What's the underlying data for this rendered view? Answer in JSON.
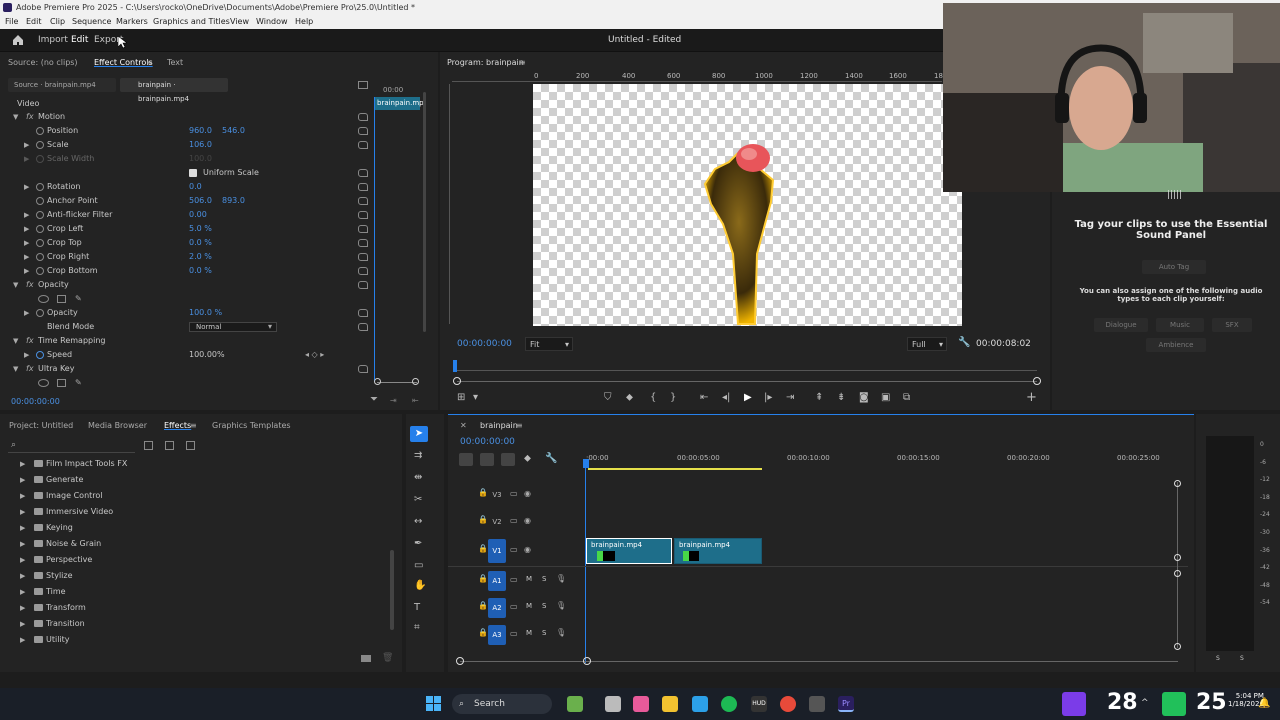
{
  "window": {
    "title": "Adobe Premiere Pro 2025 - C:\\Users\\rocko\\OneDrive\\Documents\\Adobe\\Premiere Pro\\25.0\\Untitled *"
  },
  "menu": [
    "File",
    "Edit",
    "Clip",
    "Sequence",
    "Markers",
    "Graphics and Titles",
    "View",
    "Window",
    "Help"
  ],
  "header": {
    "import": "Import",
    "edit": "Edit",
    "export": "Export",
    "project_title": "Untitled - Edited"
  },
  "source_panel": {
    "tabs": [
      "Source: (no clips)",
      "Effect Controls",
      "Text"
    ],
    "sub_tabs": [
      "Source · brainpain.mp4",
      "brainpain · brainpain.mp4"
    ],
    "mini_time": "00:00",
    "mini_clip": "brainpain.mp",
    "timecode": "00:00:00:00"
  },
  "effect_controls": {
    "video": "Video",
    "motion": "Motion",
    "position": "Position",
    "position_x": "960.0",
    "position_y": "546.0",
    "scale": "Scale",
    "scale_val": "106.0",
    "scale_width": "Scale Width",
    "scale_width_val": "100.0",
    "uniform": "Uniform Scale",
    "rotation": "Rotation",
    "rotation_val": "0.0",
    "anchor": "Anchor Point",
    "anchor_x": "506.0",
    "anchor_y": "893.0",
    "antiflicker": "Anti-flicker Filter",
    "antiflicker_val": "0.00",
    "crop_left": "Crop Left",
    "crop_left_val": "5.0 %",
    "crop_top": "Crop Top",
    "crop_top_val": "0.0 %",
    "crop_right": "Crop Right",
    "crop_right_val": "2.0 %",
    "crop_bottom": "Crop Bottom",
    "crop_bottom_val": "0.0 %",
    "opacity_group": "Opacity",
    "opacity": "Opacity",
    "opacity_val": "100.0 %",
    "blend": "Blend Mode",
    "blend_val": "Normal",
    "time_remap": "Time Remapping",
    "speed": "Speed",
    "speed_val": "100.00%",
    "ultra_key": "Ultra Key"
  },
  "program": {
    "title": "Program: brainpain",
    "ruler": [
      "0",
      "200",
      "400",
      "600",
      "800",
      "1000",
      "1200",
      "1400",
      "1600",
      "18"
    ],
    "timecode": "00:00:00:00",
    "fit": "Fit",
    "full": "Full",
    "duration": "00:00:08:02"
  },
  "sound_panel": {
    "heading": "Tag your clips to use the Essential Sound Panel",
    "auto_tag": "Auto Tag",
    "desc": "You can also assign one of the following audio types to each clip yourself:",
    "dialogue": "Dialogue",
    "music": "Music",
    "sfx": "SFX",
    "ambience": "Ambience"
  },
  "project_panel": {
    "tabs": [
      "Project: Untitled",
      "Media Browser",
      "Effects",
      "Graphics Templates"
    ],
    "search_placeholder": "",
    "effects": [
      "Film Impact Tools FX",
      "Generate",
      "Image Control",
      "Immersive Video",
      "Keying",
      "Noise & Grain",
      "Perspective",
      "Stylize",
      "Time",
      "Transform",
      "Transition",
      "Utility"
    ]
  },
  "timeline": {
    "title": "brainpain",
    "timecode": "00:00:00:00",
    "ruler": [
      ":00:00",
      "00:00:05:00",
      "00:00:10:00",
      "00:00:15:00",
      "00:00:20:00",
      "00:00:25:00"
    ],
    "video_tracks": [
      "V3",
      "V2",
      "V1"
    ],
    "audio_tracks": [
      "A1",
      "A2",
      "A3"
    ],
    "clips": [
      "brainpain.mp4",
      "brainpain.mp4"
    ],
    "mute": "M",
    "solo": "S"
  },
  "meter": {
    "scale": [
      "0",
      "-6",
      "-12",
      "-18",
      "-24",
      "-30",
      "-36",
      "-42",
      "-48",
      "-54"
    ],
    "s1": "S",
    "s2": "S"
  },
  "taskbar": {
    "search": "Search",
    "temp": "28",
    "time": "5:04 PM",
    "date": "1/18/2026",
    "big": "25"
  },
  "colors": {
    "accent": "#2680eb",
    "clip": "#1e6e8a",
    "playhead": "#2680eb"
  }
}
